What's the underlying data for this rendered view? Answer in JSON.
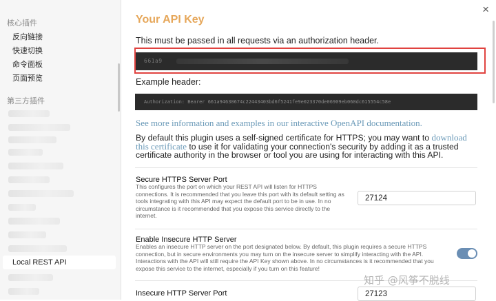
{
  "sidebar": {
    "core_heading": "核心插件",
    "core_items": [
      "反向链接",
      "快速切换",
      "命令面板",
      "页面预览"
    ],
    "third_heading": "第三方插件",
    "active_item": "Local REST API"
  },
  "modal": {
    "close_icon": "×",
    "title": "Your API Key",
    "api_key_desc": "This must be passed in all requests via an authorization header.",
    "api_key_value": "661a9",
    "example_label": "Example header:",
    "example_header_value": "Authorization: Bearer 661a94630674c22443403bd6f5241fe9e023370de06909eb060dc615554c58e",
    "doc_link": "See more information and examples in our interactive OpenAPI documentation.",
    "cert_text_before": "By default this plugin uses a self-signed certificate for HTTPS; you may want to ",
    "cert_link": "download this certificate",
    "cert_text_after": " to use it for validating your connection's security by adding it as a trusted certificate authority in the browser or tool you are using for interacting with this API."
  },
  "settings": {
    "https_port": {
      "title": "Secure HTTPS Server Port",
      "desc": "This configures the port on which your REST API will listen for HTTPS connections. It is recommended that you leave this port with its default setting as tools integrating with this API may expect the default port to be in use. In no circumstance is it recommended that you expose this service directly to the internet.",
      "value": "27124"
    },
    "insecure_http": {
      "title": "Enable Insecure HTTP Server",
      "desc": "Enables an insecure HTTP server on the port designated below. By default, this plugin requires a secure HTTPS connection, but in secure environments you may turn on the insecure server to simplify interacting with the API. Interactions with the API will still require the API Key shown above. In no circumstances is it recommended that you expose this service to the internet, especially if you turn on this feature!",
      "enabled": true
    },
    "http_port": {
      "title": "Insecure HTTP Server Port",
      "value": "27123"
    }
  },
  "watermark": "知乎 @风筝不脱线",
  "colors": {
    "title": "#e6a75a",
    "link": "#6b9ab8",
    "toggle_on": "#6a8eb4",
    "highlight": "#e0423f"
  }
}
